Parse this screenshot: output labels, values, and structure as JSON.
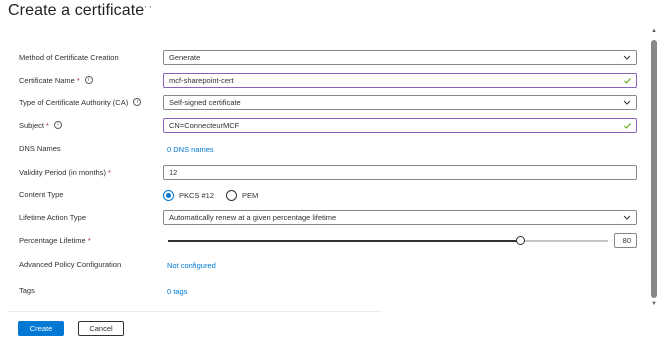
{
  "header": {
    "title": "Create a certificate",
    "more_glyph": "···"
  },
  "form": {
    "method": {
      "label": "Method of Certificate Creation",
      "value": "Generate"
    },
    "cert_name": {
      "label": "Certificate Name",
      "required": "*",
      "value": "mcf-sharepoint-cert"
    },
    "ca_type": {
      "label": "Type of Certificate Authority (CA)",
      "value": "Self-signed certificate"
    },
    "subject": {
      "label": "Subject",
      "required": "*",
      "value": "CN=ConnecteurMCF"
    },
    "dns": {
      "label": "DNS Names",
      "link": "0 DNS names"
    },
    "validity": {
      "label": "Validity Period (in months)",
      "required": "*",
      "value": "12"
    },
    "content_type": {
      "label": "Content Type",
      "options": [
        "PKCS #12",
        "PEM"
      ],
      "selected": "PKCS #12"
    },
    "lifetime_action": {
      "label": "Lifetime Action Type",
      "value": "Automatically renew at a given percentage lifetime"
    },
    "percentage": {
      "label": "Percentage Lifetime",
      "required": "*",
      "value": "80",
      "level_percent": 80
    },
    "advanced": {
      "label": "Advanced Policy Configuration",
      "link": "Not configured"
    },
    "tags": {
      "label": "Tags",
      "link": "0 tags"
    }
  },
  "icons": {
    "info": "info-icon",
    "chevron": "chevron-down-icon",
    "valid": "checkmark-icon",
    "more": "more-icon"
  },
  "colors": {
    "accent": "#0078d4",
    "valid_border": "#8764b8",
    "valid_check": "#57a300",
    "required": "#a4262c"
  },
  "buttons": {
    "create": "Create",
    "cancel": "Cancel"
  }
}
